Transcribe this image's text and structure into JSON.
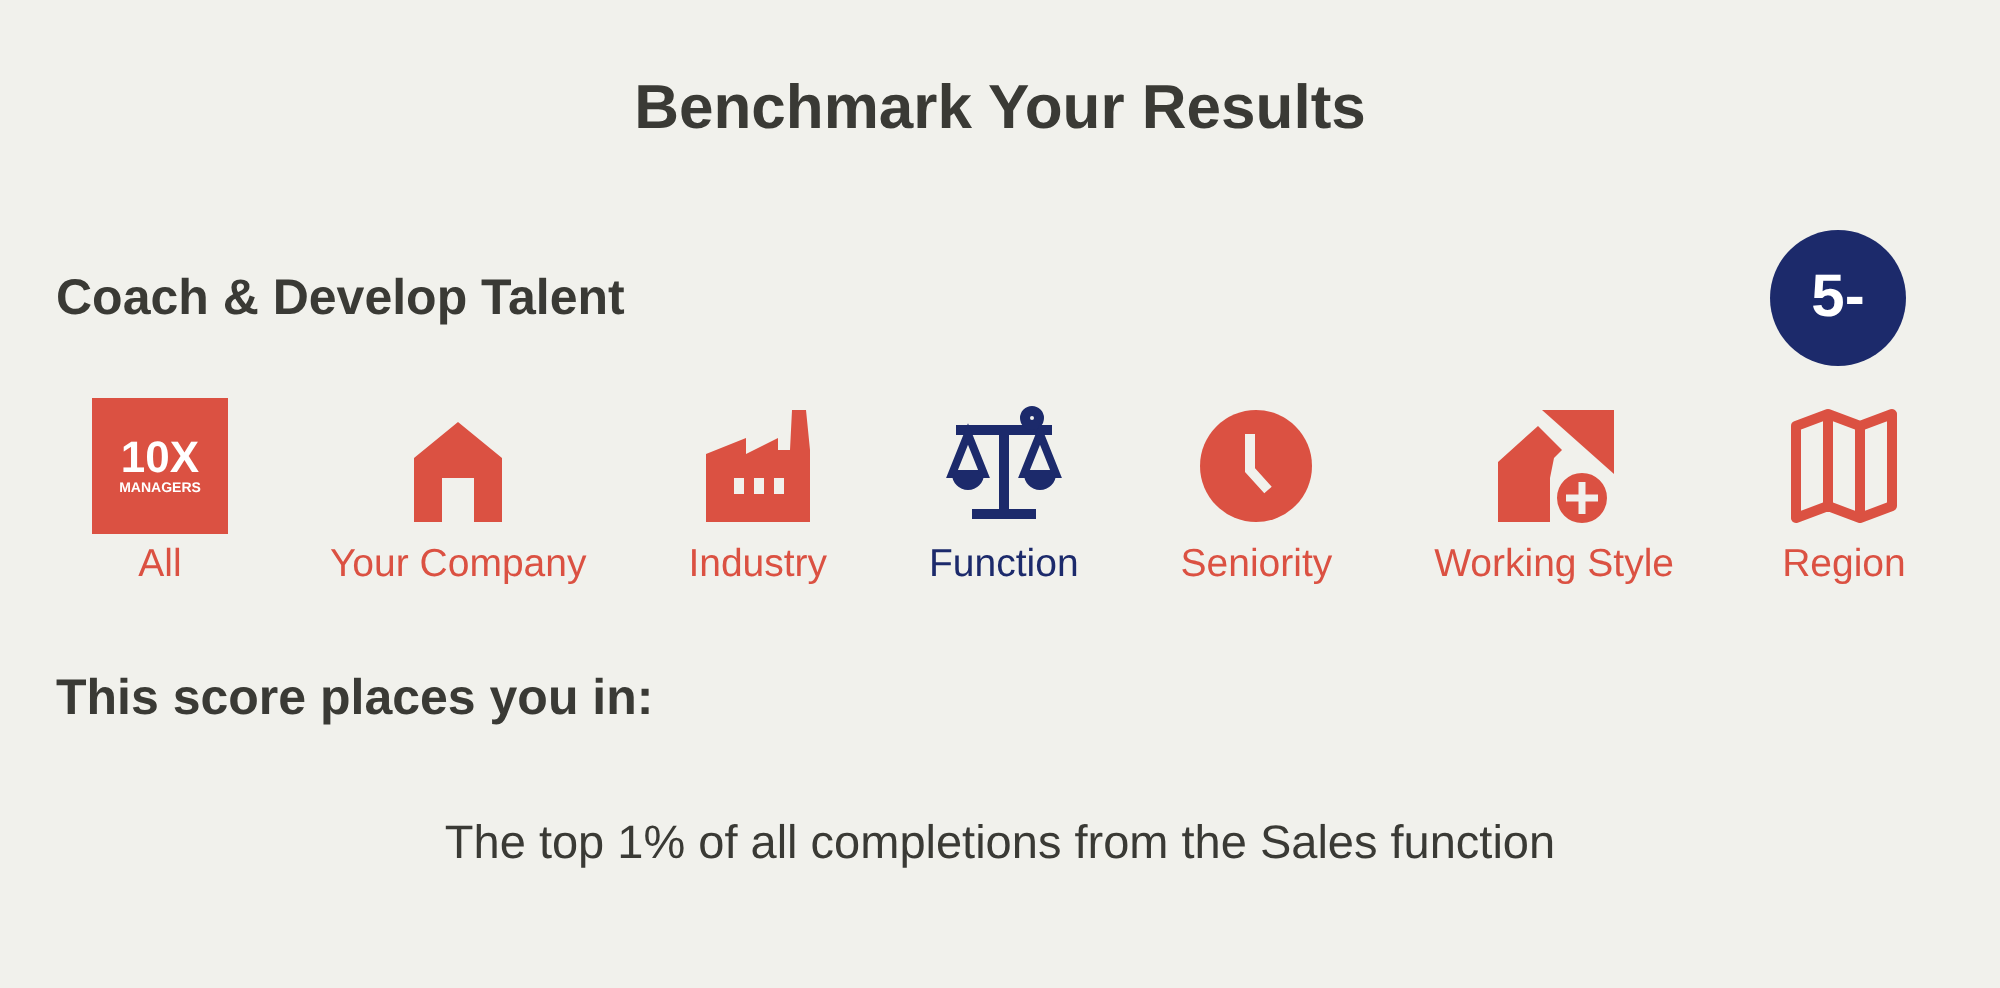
{
  "title": "Benchmark Your Results",
  "competency": {
    "name": "Coach & Develop Talent",
    "score": "5-"
  },
  "logo": {
    "mark": "10X",
    "caption": "MANAGERS"
  },
  "filters": [
    {
      "label": "All",
      "selected": false
    },
    {
      "label": "Your Company",
      "selected": false
    },
    {
      "label": "Industry",
      "selected": false
    },
    {
      "label": "Function",
      "selected": true
    },
    {
      "label": "Seniority",
      "selected": false
    },
    {
      "label": "Working Style",
      "selected": false
    },
    {
      "label": "Region",
      "selected": false
    }
  ],
  "result": {
    "heading": "This score places you in:",
    "text": "The top 1% of all completions from the Sales function"
  }
}
